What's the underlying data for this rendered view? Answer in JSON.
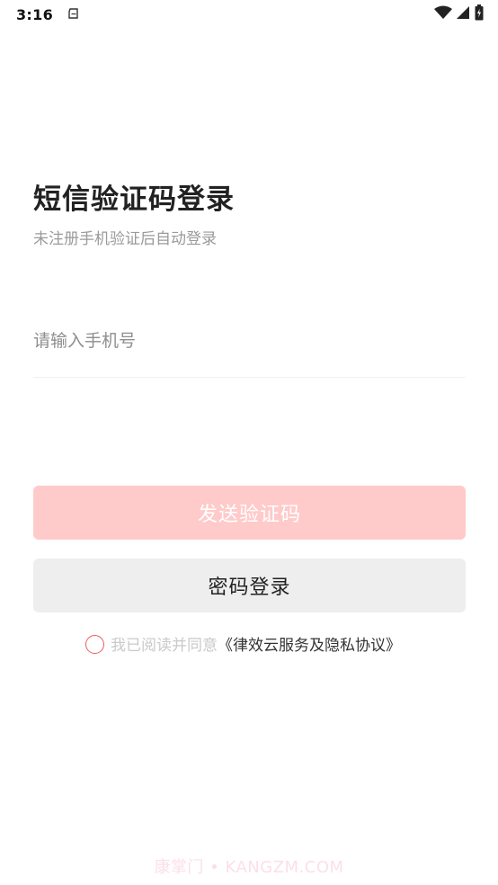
{
  "status_bar": {
    "time": "3:16",
    "icons": [
      "notification-icon",
      "wifi-icon",
      "signal-icon",
      "battery-icon"
    ]
  },
  "header": {
    "title": "短信验证码登录",
    "subtitle": "未注册手机验证后自动登录"
  },
  "form": {
    "phone_placeholder": "请输入手机号",
    "phone_value": ""
  },
  "buttons": {
    "send_code": "发送验证码",
    "password_login": "密码登录"
  },
  "agreement": {
    "checked": false,
    "text": "我已阅读并同意",
    "link": "《律效云服务及隐私协议》"
  },
  "watermark": "康掌门 • KANGZM.COM",
  "colors": {
    "send_button_bg": "#ffcaca",
    "password_button_bg": "#eeeeee",
    "radio_border": "#ee5a5a",
    "title_text": "#222222",
    "muted_text": "#9a9a9a"
  }
}
